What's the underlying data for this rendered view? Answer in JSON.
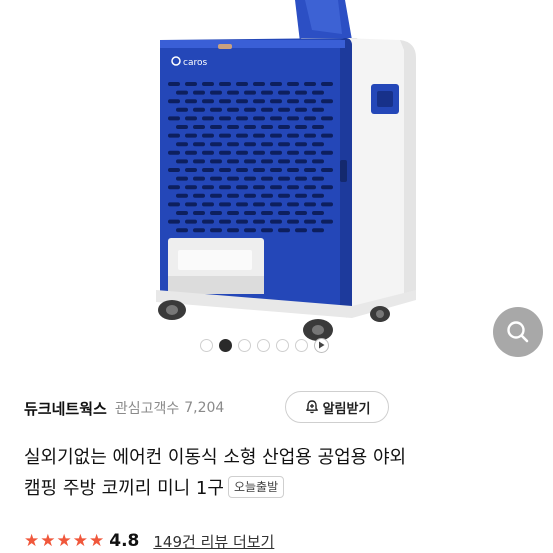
{
  "product": {
    "brand_mark": "caros",
    "image_alt": "포터블 이동식 에어컨 제품 이미지"
  },
  "gallery": {
    "dot_count": 6,
    "active_index": 1
  },
  "seller": {
    "name": "듀크네트웍스",
    "follower_label": "관심고객수",
    "follower_count": "7,204",
    "alert_button_label": "알림받기"
  },
  "title": {
    "line1": "실외기없는 에어컨 이동식 소형 산업용 공업용 야외",
    "line2": "캠핑 주방 코끼리 미니 1구",
    "badge": "오늘출발"
  },
  "rating": {
    "stars": 5,
    "value": "4.8",
    "review_link": "149건 리뷰 더보기",
    "star_color": "#f0573b"
  },
  "colors": {
    "body_blue": "#2447b8",
    "zoom_button": "#a8a8a8"
  }
}
